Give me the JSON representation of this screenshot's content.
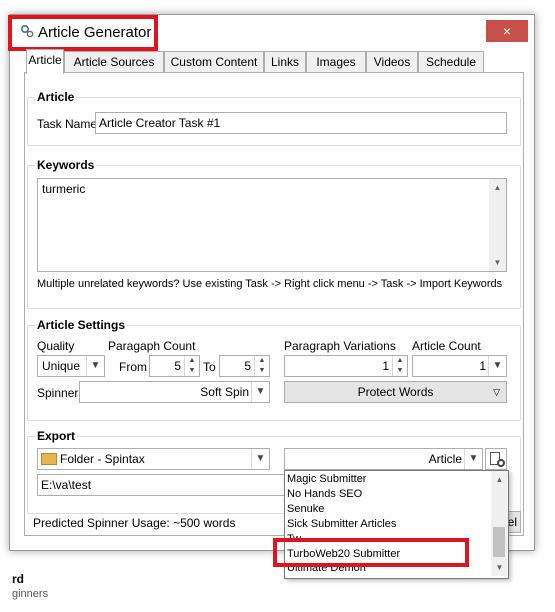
{
  "window": {
    "title": "Article Generator",
    "close_icon": "×"
  },
  "tabs": [
    "Article",
    "Article Sources",
    "Custom Content",
    "Links",
    "Images",
    "Videos",
    "Schedule"
  ],
  "article": {
    "group_title": "Article",
    "task_name_label": "Task Name",
    "task_name_value": "Article Creator Task #1"
  },
  "keywords": {
    "group_title": "Keywords",
    "value": "turmeric",
    "hint": "Multiple unrelated keywords? Use existing Task -> Right click menu -> Task -> Import Keywords"
  },
  "settings": {
    "group_title": "Article Settings",
    "quality_label": "Quality",
    "quality_value": "Unique",
    "paragraph_count_label": "Paragaph Count",
    "from_label": "From",
    "from_value": "5",
    "to_label": "To",
    "to_value": "5",
    "para_variations_label": "Paragraph Variations",
    "para_variations_value": "1",
    "article_count_label": "Article Count",
    "article_count_value": "1",
    "spinner_label": "Spinner",
    "spinner_value": "Soft Spin",
    "protect_words_label": "Protect Words"
  },
  "export": {
    "group_title": "Export",
    "folder_value": "Folder - Spintax",
    "type_value": "Article",
    "path_value": "E:\\va\\test",
    "options": [
      "Magic Submitter",
      "No Hands SEO",
      "Senuke",
      "Sick Submitter Articles",
      "Tw...",
      "TurboWeb20 Submitter",
      "Ultimate Demon"
    ]
  },
  "footer": {
    "predicted_usage": "Predicted Spinner Usage: ~500 words",
    "button_partial": "el"
  },
  "behind": {
    "text1": "rd",
    "text2": "ginners"
  }
}
